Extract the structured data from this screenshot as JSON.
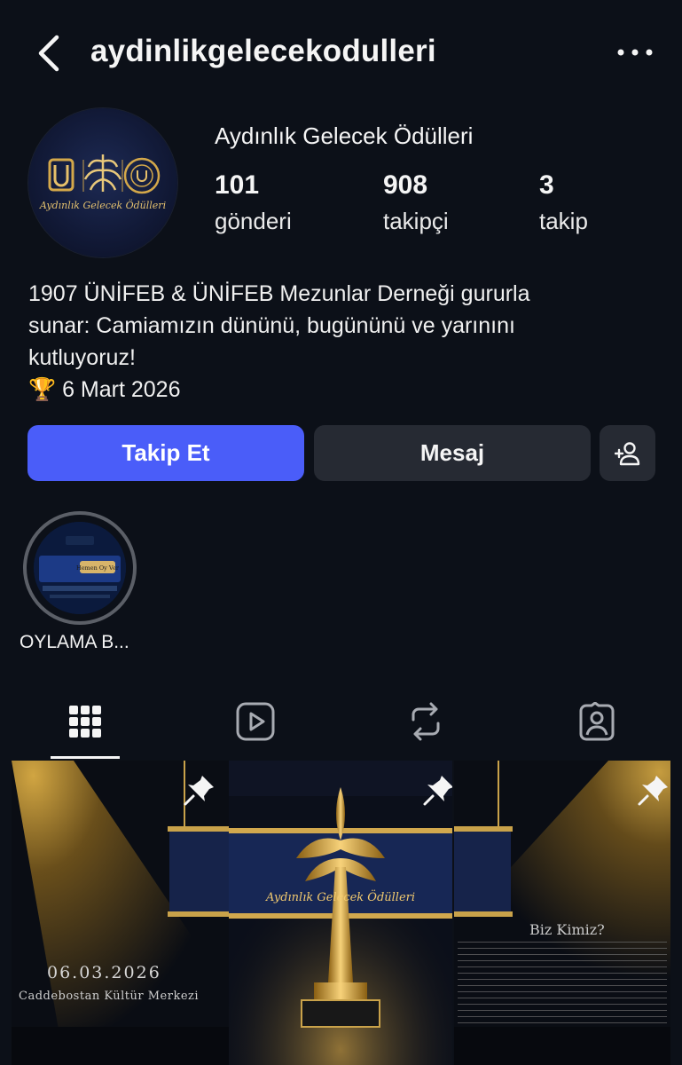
{
  "header": {
    "username": "aydinlikgelecekodulleri",
    "back_icon": "chevron-left-icon",
    "more_icon": "more-horizontal-icon"
  },
  "profile": {
    "display_name": "Aydınlık Gelecek Ödülleri",
    "avatar_text": "Aydınlık Gelecek Ödülleri",
    "stats": {
      "posts": {
        "value": "101",
        "label": "gönderi"
      },
      "followers": {
        "value": "908",
        "label": "takipçi"
      },
      "following": {
        "value": "3",
        "label": "takip"
      }
    },
    "bio_lines": [
      "1907 ÜNİFEB & ÜNİFEB Mezunlar Derneği gururla",
      "sunar: Camiamızın dününü, bugününü ve yarınını",
      "kutluyoruz!",
      "🏆 6 Mart 2026"
    ]
  },
  "actions": {
    "follow_label": "Takip Et",
    "message_label": "Mesaj",
    "add_person_icon": "add-person-icon",
    "follow_color": "#4a5df9"
  },
  "highlights": [
    {
      "label": "OYLAMA B...",
      "inner_text": "Hemen Oy Ver"
    }
  ],
  "tabs": [
    {
      "icon": "grid-icon",
      "active": true
    },
    {
      "icon": "reels-icon",
      "active": false
    },
    {
      "icon": "reposts-icon",
      "active": false
    },
    {
      "icon": "tagged-icon",
      "active": false
    }
  ],
  "posts": [
    {
      "pinned": true,
      "date": "06.03.2026",
      "place": "Caddebostan Kültür Merkezi"
    },
    {
      "pinned": true,
      "banner_text": "Aydınlık Gelecek Ödülleri"
    },
    {
      "pinned": true,
      "title": "Biz Kimiz?"
    }
  ]
}
